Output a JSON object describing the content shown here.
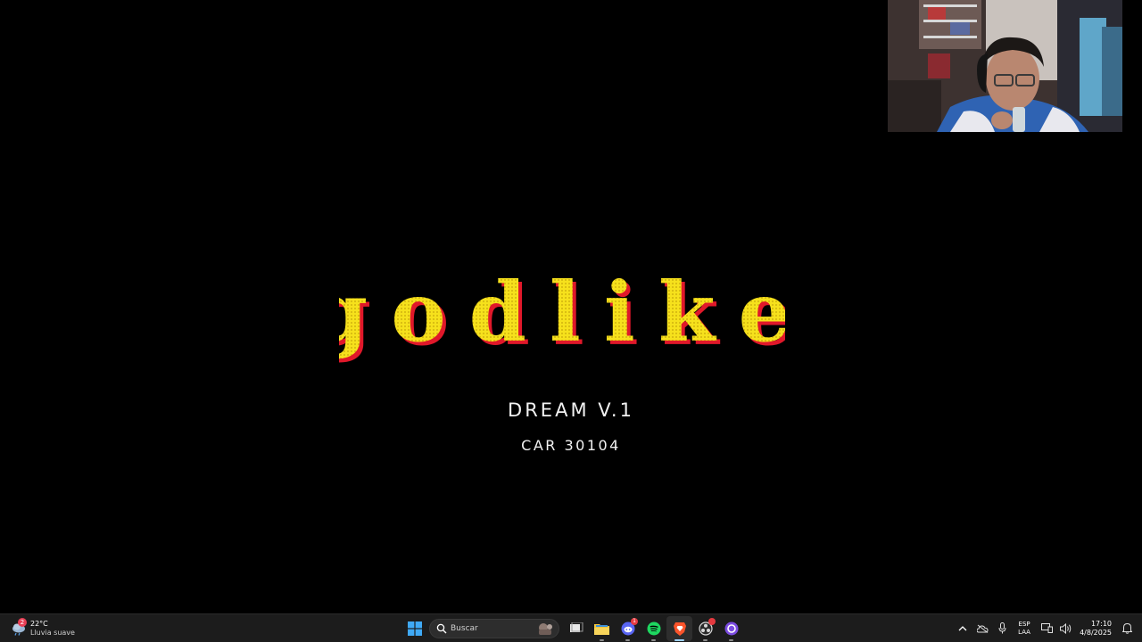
{
  "screen": {
    "logo_text": "godlike",
    "subtitle_line1": "DREAM V.1",
    "subtitle_line2": "CAR 30104",
    "logo_colors": {
      "fill": "#f6e11c",
      "shadow": "#e0182a",
      "dots": "#c7a60a"
    }
  },
  "webcam": {
    "description_icon": "webcam-overlay"
  },
  "taskbar": {
    "weather": {
      "temp": "22°C",
      "desc": "Lluvia suave",
      "badge": "2",
      "icon": "rain-cloud-icon"
    },
    "search": {
      "placeholder": "Buscar"
    },
    "apps": [
      {
        "name": "start",
        "icon": "windows-start-icon"
      },
      {
        "name": "task-view",
        "icon": "task-view-icon"
      },
      {
        "name": "file-explorer",
        "icon": "folder-icon"
      },
      {
        "name": "discord",
        "icon": "discord-icon",
        "badge": "1"
      },
      {
        "name": "spotify",
        "icon": "spotify-icon"
      },
      {
        "name": "brave",
        "icon": "brave-icon"
      },
      {
        "name": "obs",
        "icon": "obs-icon"
      },
      {
        "name": "cortana",
        "icon": "circle-app-icon"
      }
    ],
    "tray": {
      "lang_top": "ESP",
      "lang_bottom": "LAA",
      "time": "17:10",
      "date": "4/8/2025"
    }
  }
}
